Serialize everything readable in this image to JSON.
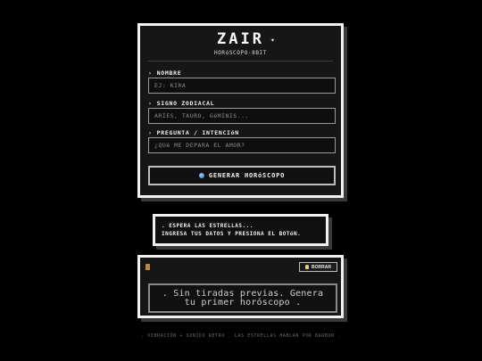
{
  "app": {
    "title": "ZAIR",
    "subtitle": "HORóSCOPO·8BIT"
  },
  "form": {
    "fields": [
      {
        "label": "NOMBRE",
        "placeholder": "EJ: KIRA"
      },
      {
        "label": "SIGNO ZODIACAL",
        "placeholder": "ARIES, TAURO, GéMINIS..."
      },
      {
        "label": "PREGUNTA / INTENCIóN",
        "placeholder": "¿QUé ME DEPARA EL AMOR?"
      }
    ],
    "caret": "›",
    "submit_label": "GENERAR HORóSCOPO"
  },
  "status": {
    "line1": ". ESPERA LAS ESTRELLAS...",
    "line2": "INGRESA TUS DATOS Y PRESIONA EL BOTóN."
  },
  "history": {
    "clear_label": "BORRAR",
    "empty_message": ". Sin tiradas previas. Genera tu primer horóscopo ."
  },
  "footer": {
    "text": ". VIBRACIÓN + SONIDO RETRO . LAS ESTRELLAS HABLAN POR BARBUR ."
  },
  "icons": {
    "sparkle": "✦",
    "orb": "orb-icon",
    "scroll": "scroll-icon",
    "bulb": "bulb-icon"
  },
  "colors": {
    "background": "#000000",
    "panel": "#161616",
    "border": "#f2f2f2",
    "orb": "#2f6fd0"
  }
}
